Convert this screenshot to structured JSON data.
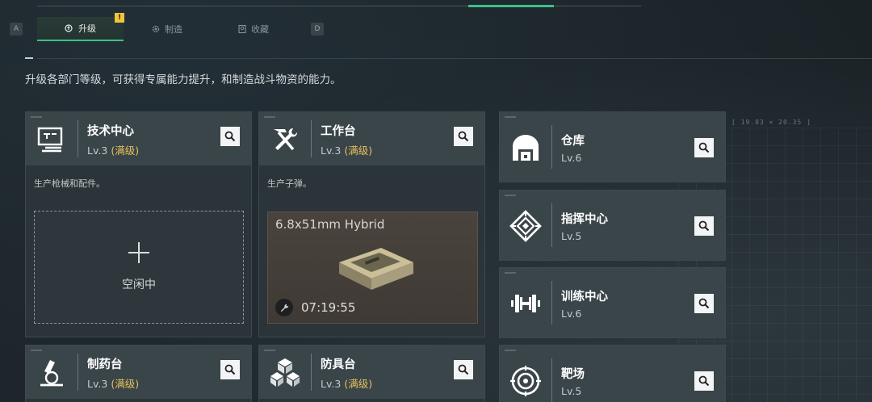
{
  "tabs": [
    {
      "key": "A"
    },
    {
      "label": "升级",
      "active": true,
      "badge": "!"
    },
    {
      "label": "制造"
    },
    {
      "label": "收藏"
    },
    {
      "key": "D"
    }
  ],
  "description": "升级各部门等级，可获得专属能力提升，和制造战斗物资的能力。",
  "hud_readout": "[ 19.83 × 20.35 ]",
  "cards": {
    "tech_center": {
      "title": "技术中心",
      "level": "Lv.3",
      "maxed": "(满级)",
      "body": "生产枪械和配件。",
      "slot_label": "空闲中",
      "icon": "computer-icon"
    },
    "workbench": {
      "title": "工作台",
      "level": "Lv.3",
      "maxed": "(满级)",
      "body": "生产子弹。",
      "product": "6.8x51mm Hybrid",
      "timer": "07:19:55",
      "icon": "hammer-wrench-icon"
    },
    "pharmacy": {
      "title": "制药台",
      "level": "Lv.3",
      "maxed": "(满级)",
      "icon": "microscope-icon"
    },
    "armor": {
      "title": "防具台",
      "level": "Lv.3",
      "maxed": "(满级)",
      "icon": "cubes-icon"
    },
    "warehouse": {
      "title": "仓库",
      "level": "Lv.6",
      "icon": "warehouse-icon"
    },
    "command": {
      "title": "指挥中心",
      "level": "Lv.5",
      "icon": "diamond-emblem-icon"
    },
    "training": {
      "title": "训练中心",
      "level": "Lv.6",
      "icon": "dumbbell-icon"
    },
    "range": {
      "title": "靶场",
      "level": "Lv.5",
      "icon": "target-icon"
    }
  },
  "colors": {
    "accent": "#3fbf8a",
    "maxed": "#e8c25a",
    "badge": "#f0c63a"
  }
}
